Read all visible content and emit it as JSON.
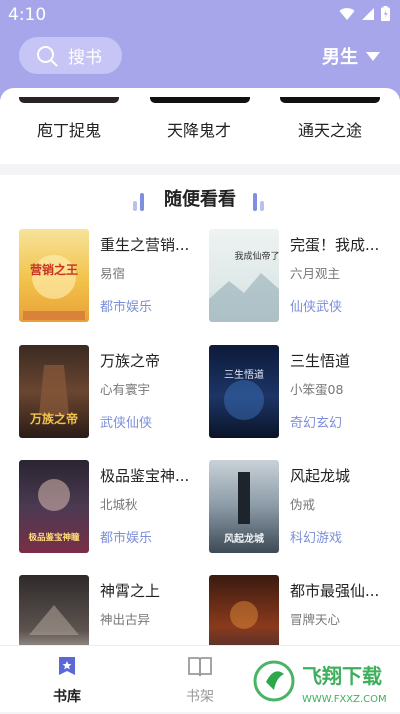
{
  "status_bar": {
    "time": "4:10"
  },
  "header": {
    "search_label": "搜书",
    "gender_label": "男生"
  },
  "top_books": [
    {
      "title": "庖丁捉鬼"
    },
    {
      "title": "天降鬼才"
    },
    {
      "title": "通天之途"
    }
  ],
  "section": {
    "title": "随便看看",
    "books": [
      {
        "title": "重生之营销...",
        "author": "易宿",
        "tag": "都市娱乐",
        "cover_text": "营销之王"
      },
      {
        "title": "完蛋！我成...",
        "author": "六月观主",
        "tag": "仙侠武侠",
        "cover_text": "我成仙帝了"
      },
      {
        "title": "万族之帝",
        "author": "心有寰宇",
        "tag": "武侠仙侠",
        "cover_text": "万族之帝"
      },
      {
        "title": "三生悟道",
        "author": "小笨蛋08",
        "tag": "奇幻玄幻",
        "cover_text": "三生悟道"
      },
      {
        "title": "极品鉴宝神...",
        "author": "北城秋",
        "tag": "都市娱乐",
        "cover_text": "极品鉴宝神瞳"
      },
      {
        "title": "风起龙城",
        "author": "伪戒",
        "tag": "科幻游戏",
        "cover_text": "风起龙城"
      },
      {
        "title": "神霄之上",
        "author": "神出古异",
        "tag": "",
        "cover_text": ""
      },
      {
        "title": "都市最强仙...",
        "author": "冒牌天心",
        "tag": "",
        "cover_text": ""
      }
    ]
  },
  "tabbar": {
    "tabs": [
      {
        "label": "书库",
        "active": true
      },
      {
        "label": "书架",
        "active": false
      }
    ]
  },
  "watermark": {
    "text": "飞翔下载",
    "url_text": "WWW.FXXZ.COM"
  },
  "colors": {
    "header": "#a7a6ea",
    "accent": "#5b68d6",
    "tag": "#7d8fd8"
  }
}
